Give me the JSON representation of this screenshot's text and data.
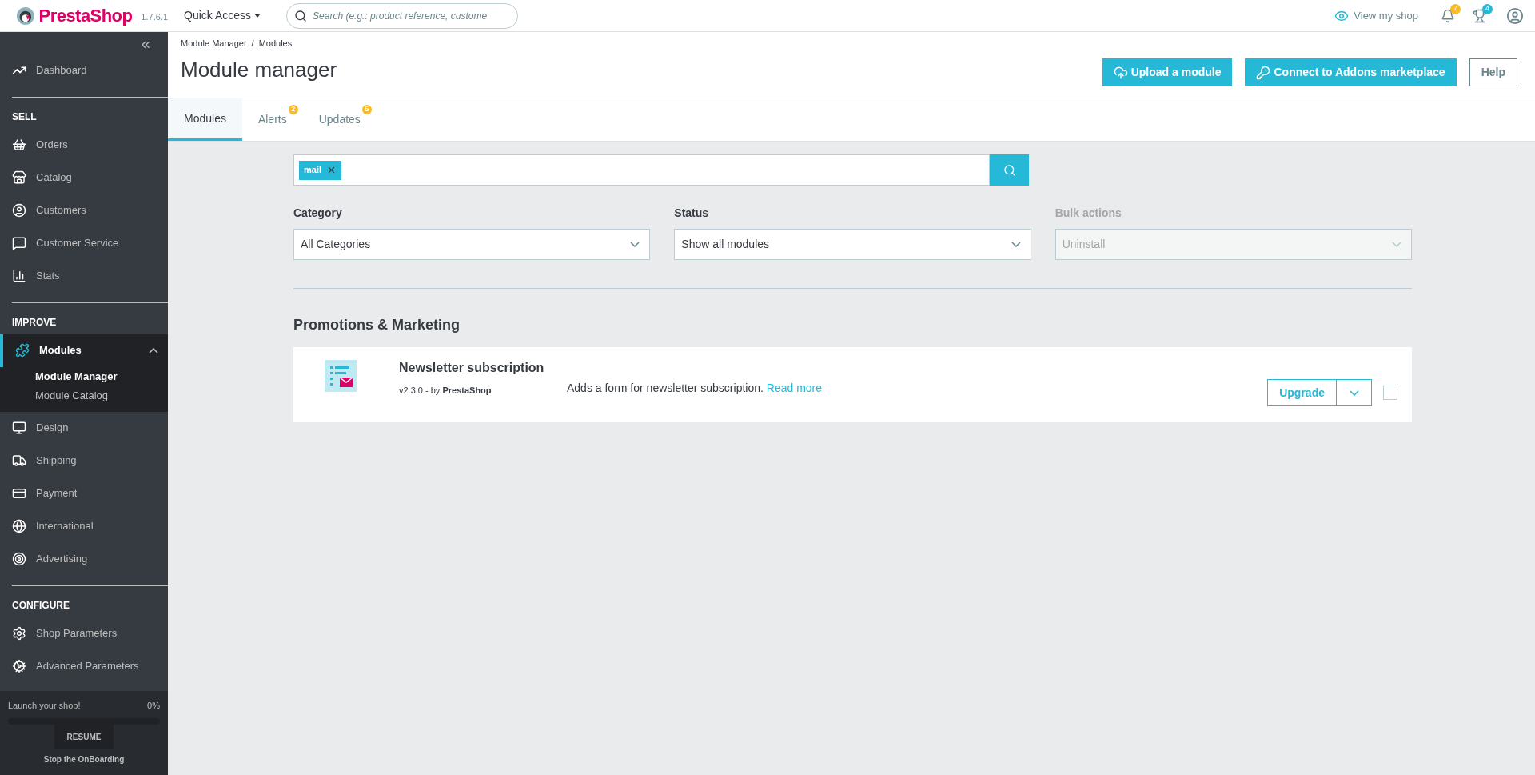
{
  "header": {
    "brand": "PrestaShop",
    "version": "1.7.6.1",
    "quick_access": "Quick Access",
    "search": {
      "placeholder": "Search (e.g.: product reference, custome"
    },
    "view_shop": "View my shop",
    "notifications": "7",
    "trophies": "4"
  },
  "sidebar": {
    "sections": [
      {
        "items": [
          {
            "label": "Dashboard",
            "selected": false
          }
        ]
      },
      {
        "title": "SELL",
        "items": [
          {
            "label": "Orders",
            "selected": false
          },
          {
            "label": "Catalog",
            "selected": false
          },
          {
            "label": "Customers",
            "selected": false
          },
          {
            "label": "Customer Service",
            "selected": false
          },
          {
            "label": "Stats",
            "selected": false
          }
        ]
      },
      {
        "title": "IMPROVE",
        "items": [
          {
            "label": "Modules",
            "selected": true,
            "expanded": true,
            "children": [
              {
                "label": "Module Manager",
                "selected": true
              },
              {
                "label": "Module Catalog",
                "selected": false
              }
            ]
          },
          {
            "label": "Design",
            "selected": false
          },
          {
            "label": "Shipping",
            "selected": false
          },
          {
            "label": "Payment",
            "selected": false
          },
          {
            "label": "International",
            "selected": false
          },
          {
            "label": "Advertising",
            "selected": false
          }
        ]
      },
      {
        "title": "CONFIGURE",
        "items": [
          {
            "label": "Shop Parameters",
            "selected": false
          },
          {
            "label": "Advanced Parameters",
            "selected": false
          }
        ]
      }
    ],
    "onboarding": {
      "title": "Launch your shop!",
      "percent": "0%",
      "level": 0,
      "resume": "RESUME",
      "stop": "Stop the OnBoarding"
    }
  },
  "breadcrumb": {
    "items": [
      "Module Manager",
      "Modules"
    ],
    "separator": "/"
  },
  "page_title": "Module manager",
  "toolbar": [
    {
      "label": "Upload a module",
      "kind": "upload"
    },
    {
      "label": "Connect to Addons marketplace",
      "kind": "key"
    },
    {
      "label": "Help",
      "kind": "outline"
    }
  ],
  "tabs": [
    {
      "label": "Modules",
      "selected": true
    },
    {
      "label": "Alerts",
      "selected": false,
      "badge": "2"
    },
    {
      "label": "Updates",
      "selected": false,
      "badge": "5"
    }
  ],
  "filter": {
    "tags": [
      "mail"
    ]
  },
  "selects": [
    {
      "label": "Category",
      "value": "All Categories",
      "disabled": false
    },
    {
      "label": "Status",
      "value": "Show all modules",
      "disabled": false
    },
    {
      "label": "Bulk actions",
      "value": "Uninstall",
      "disabled": true
    }
  ],
  "section_title": "Promotions & Marketing",
  "modules": [
    {
      "name": "Newsletter subscription",
      "version": "v2.3.0 - by ",
      "author": "PrestaShop",
      "description": "Adds a form for newsletter subscription.",
      "read_more": "Read more",
      "action": "Upgrade",
      "checked": false
    }
  ]
}
